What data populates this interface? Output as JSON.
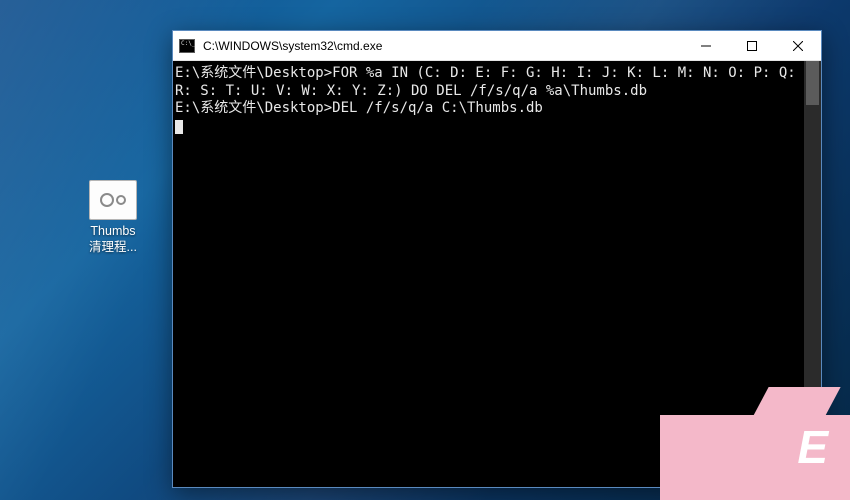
{
  "desktop": {
    "icon": {
      "label": "Thumbs\n清理程..."
    }
  },
  "window": {
    "title": "C:\\WINDOWS\\system32\\cmd.exe",
    "controls": {
      "minimize": "Minimize",
      "maximize": "Maximize",
      "close": "Close"
    }
  },
  "terminal": {
    "lines": [
      "",
      "E:\\系统文件\\Desktop>FOR %a IN (C: D: E: F: G: H: I: J: K: L: M: N: O: P: Q: R: S: T: U: V: W: X: Y: Z:) DO DEL /f/s/q/a %a\\Thumbs.db",
      "",
      "E:\\系统文件\\Desktop>DEL /f/s/q/a C:\\Thumbs.db"
    ],
    "prompt_cursor": true
  },
  "colors": {
    "titlebar_bg": "#ffffff",
    "terminal_bg": "#000000",
    "terminal_fg": "#e8e8e8",
    "desktop_bg": "#0d5aa0",
    "watermark": "#f4b8c9"
  }
}
